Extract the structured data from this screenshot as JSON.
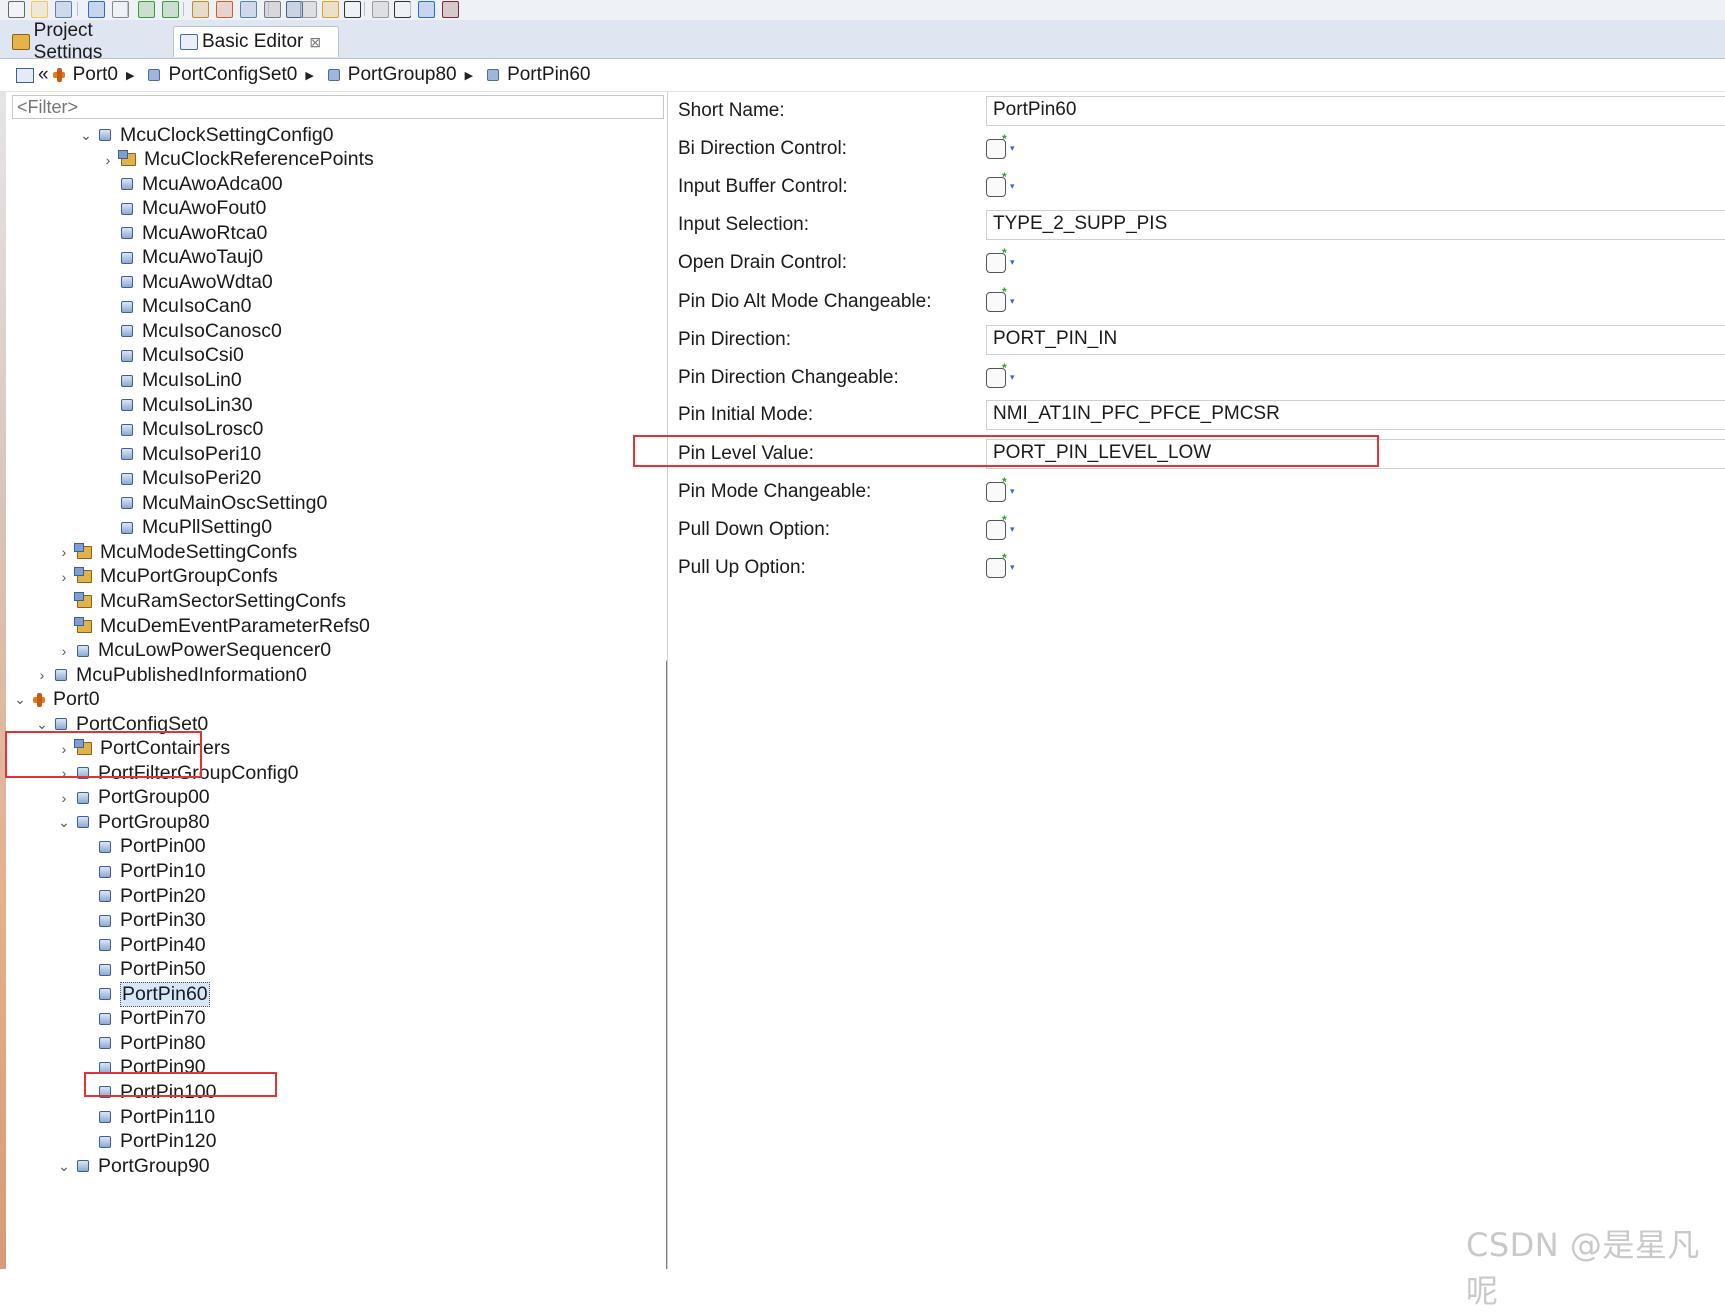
{
  "toolbar": {
    "icons": [
      "new-icon",
      "open-icon",
      "save-icon",
      "undo-icon",
      "redo-icon",
      "validate-icon",
      "verify-icon",
      "generate-icon",
      "import-icon",
      "export-icon",
      "settings-icon",
      "search-icon",
      "back-icon",
      "back-arrow-icon",
      "dropdown-icon",
      "forward-icon",
      "dropdown-icon",
      "hex-icon",
      "sort-icon"
    ]
  },
  "tabs": [
    {
      "label": "Project Settings"
    },
    {
      "label": "Basic Editor",
      "close": "⊠"
    }
  ],
  "breadcrumb": {
    "overflow": "«",
    "items": [
      "Port0",
      "PortConfigSet0",
      "PortGroup80",
      "PortPin60"
    ]
  },
  "filter": {
    "placeholder": "<Filter>"
  },
  "tree": [
    {
      "label": "McuClockSettingConfig0",
      "depth": 3,
      "icon": "node",
      "twisty": "open"
    },
    {
      "label": "McuClockReferencePoints",
      "depth": 4,
      "icon": "folder",
      "twisty": "closed"
    },
    {
      "label": "McuAwoAdca00",
      "depth": 4,
      "icon": "node",
      "twisty": "none"
    },
    {
      "label": "McuAwoFout0",
      "depth": 4,
      "icon": "node",
      "twisty": "none"
    },
    {
      "label": "McuAwoRtca0",
      "depth": 4,
      "icon": "node",
      "twisty": "none"
    },
    {
      "label": "McuAwoTauj0",
      "depth": 4,
      "icon": "node",
      "twisty": "none"
    },
    {
      "label": "McuAwoWdta0",
      "depth": 4,
      "icon": "node",
      "twisty": "none"
    },
    {
      "label": "McuIsoCan0",
      "depth": 4,
      "icon": "node",
      "twisty": "none"
    },
    {
      "label": "McuIsoCanosc0",
      "depth": 4,
      "icon": "node",
      "twisty": "none"
    },
    {
      "label": "McuIsoCsi0",
      "depth": 4,
      "icon": "node",
      "twisty": "none"
    },
    {
      "label": "McuIsoLin0",
      "depth": 4,
      "icon": "node",
      "twisty": "none"
    },
    {
      "label": "McuIsoLin30",
      "depth": 4,
      "icon": "node",
      "twisty": "none"
    },
    {
      "label": "McuIsoLrosc0",
      "depth": 4,
      "icon": "node",
      "twisty": "none"
    },
    {
      "label": "McuIsoPeri10",
      "depth": 4,
      "icon": "node",
      "twisty": "none"
    },
    {
      "label": "McuIsoPeri20",
      "depth": 4,
      "icon": "node",
      "twisty": "none"
    },
    {
      "label": "McuMainOscSetting0",
      "depth": 4,
      "icon": "node",
      "twisty": "none"
    },
    {
      "label": "McuPllSetting0",
      "depth": 4,
      "icon": "node",
      "twisty": "none"
    },
    {
      "label": "McuModeSettingConfs",
      "depth": 2,
      "icon": "folder",
      "twisty": "closed"
    },
    {
      "label": "McuPortGroupConfs",
      "depth": 2,
      "icon": "folder",
      "twisty": "closed"
    },
    {
      "label": "McuRamSectorSettingConfs",
      "depth": 2,
      "icon": "folder",
      "twisty": "none"
    },
    {
      "label": "McuDemEventParameterRefs0",
      "depth": 2,
      "icon": "folder",
      "twisty": "none"
    },
    {
      "label": "McuLowPowerSequencer0",
      "depth": 2,
      "icon": "node",
      "twisty": "closed"
    },
    {
      "label": "McuPublishedInformation0",
      "depth": 1,
      "icon": "node",
      "twisty": "closed"
    },
    {
      "label": "Port0",
      "depth": 0,
      "icon": "module",
      "twisty": "open"
    },
    {
      "label": "PortConfigSet0",
      "depth": 1,
      "icon": "node",
      "twisty": "open"
    },
    {
      "label": "PortContainers",
      "depth": 2,
      "icon": "folder",
      "twisty": "closed"
    },
    {
      "label": "PortFilterGroupConfig0",
      "depth": 2,
      "icon": "node",
      "twisty": "closed"
    },
    {
      "label": "PortGroup00",
      "depth": 2,
      "icon": "node",
      "twisty": "closed"
    },
    {
      "label": "PortGroup80",
      "depth": 2,
      "icon": "node",
      "twisty": "open"
    },
    {
      "label": "PortPin00",
      "depth": 3,
      "icon": "node",
      "twisty": "none"
    },
    {
      "label": "PortPin10",
      "depth": 3,
      "icon": "node",
      "twisty": "none"
    },
    {
      "label": "PortPin20",
      "depth": 3,
      "icon": "node",
      "twisty": "none"
    },
    {
      "label": "PortPin30",
      "depth": 3,
      "icon": "node",
      "twisty": "none"
    },
    {
      "label": "PortPin40",
      "depth": 3,
      "icon": "node",
      "twisty": "none"
    },
    {
      "label": "PortPin50",
      "depth": 3,
      "icon": "node",
      "twisty": "none"
    },
    {
      "label": "PortPin60",
      "depth": 3,
      "icon": "node",
      "twisty": "none",
      "selected": true
    },
    {
      "label": "PortPin70",
      "depth": 3,
      "icon": "node",
      "twisty": "none"
    },
    {
      "label": "PortPin80",
      "depth": 3,
      "icon": "node",
      "twisty": "none"
    },
    {
      "label": "PortPin90",
      "depth": 3,
      "icon": "node",
      "twisty": "none"
    },
    {
      "label": "PortPin100",
      "depth": 3,
      "icon": "node",
      "twisty": "none"
    },
    {
      "label": "PortPin110",
      "depth": 3,
      "icon": "node",
      "twisty": "none"
    },
    {
      "label": "PortPin120",
      "depth": 3,
      "icon": "node",
      "twisty": "none"
    },
    {
      "label": "PortGroup90",
      "depth": 2,
      "icon": "node",
      "twisty": "open"
    }
  ],
  "properties": [
    {
      "label": "Short Name:",
      "type": "text",
      "value": "PortPin60"
    },
    {
      "label": "Bi Direction Control:",
      "type": "check",
      "checked": false
    },
    {
      "label": "Input Buffer Control:",
      "type": "check",
      "checked": false
    },
    {
      "label": "Input Selection:",
      "type": "text",
      "value": "TYPE_2_SUPP_PIS"
    },
    {
      "label": "Open Drain Control:",
      "type": "check",
      "checked": false
    },
    {
      "label": "Pin Dio Alt Mode Changeable:",
      "type": "check",
      "checked": false
    },
    {
      "label": "Pin Direction:",
      "type": "text",
      "value": "PORT_PIN_IN"
    },
    {
      "label": "Pin Direction Changeable:",
      "type": "check",
      "checked": false
    },
    {
      "label": "Pin Initial Mode:",
      "type": "text",
      "value": "NMI_AT1IN_PFC_PFCE_PMCSR"
    },
    {
      "label": "Pin Level Value:",
      "type": "text",
      "value": "PORT_PIN_LEVEL_LOW"
    },
    {
      "label": "Pin Mode Changeable:",
      "type": "check",
      "checked": false
    },
    {
      "label": "Pull Down Option:",
      "type": "check",
      "checked": false
    },
    {
      "label": "Pull Up Option:",
      "type": "check",
      "checked": false
    }
  ],
  "check_marks": {
    "star": "*",
    "arrow": "▾"
  },
  "twisty_glyphs": {
    "open": "⌄",
    "closed": "›"
  },
  "watermark": "CSDN @是星凡呢",
  "colors": {
    "highlight": "#e23434",
    "selection": "#d6e6fb",
    "tab_bar": "#dfe6f1"
  }
}
